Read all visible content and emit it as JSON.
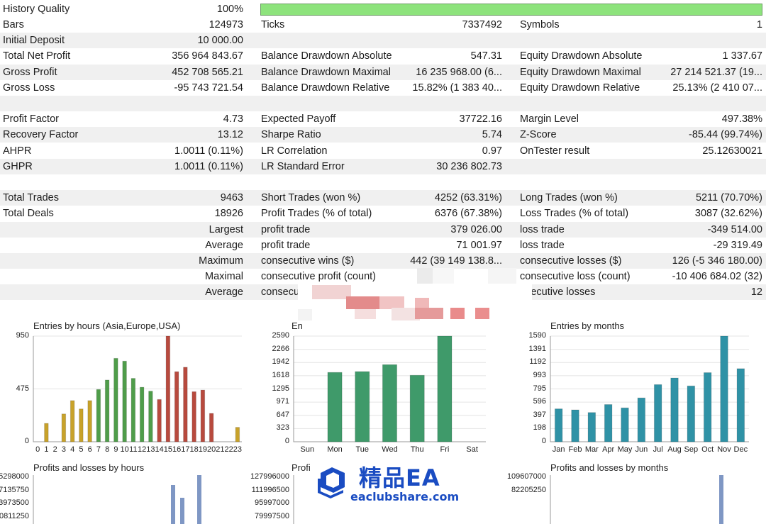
{
  "report": {
    "history_quality": {
      "label": "History Quality",
      "value": "100%",
      "fill": 1.0
    },
    "rows": [
      {
        "shade": false,
        "cells": [
          [
            "l1",
            "Bars"
          ],
          [
            "v1",
            "124973"
          ],
          [
            "l2",
            "Ticks"
          ],
          [
            "v2",
            "7337492"
          ],
          [
            "l3",
            "Symbols"
          ],
          [
            "v3",
            "1"
          ]
        ]
      },
      {
        "shade": true,
        "cells": [
          [
            "l1",
            "Initial Deposit"
          ],
          [
            "v1",
            "10 000.00"
          ]
        ]
      },
      {
        "shade": false,
        "cells": [
          [
            "l1",
            "Total Net Profit"
          ],
          [
            "v1",
            "356 964 843.67"
          ],
          [
            "l2",
            "Balance Drawdown Absolute"
          ],
          [
            "v2",
            "547.31"
          ],
          [
            "l3",
            "Equity Drawdown Absolute"
          ],
          [
            "v3",
            "1 337.67"
          ]
        ]
      },
      {
        "shade": true,
        "cells": [
          [
            "l1",
            "Gross Profit"
          ],
          [
            "v1",
            "452 708 565.21"
          ],
          [
            "l2",
            "Balance Drawdown Maximal"
          ],
          [
            "v2",
            "16 235 968.00 (6..."
          ],
          [
            "l3",
            "Equity Drawdown Maximal"
          ],
          [
            "v3",
            "27 214 521.37 (19..."
          ]
        ]
      },
      {
        "shade": false,
        "cells": [
          [
            "l1",
            "Gross Loss"
          ],
          [
            "v1",
            "-95 743 721.54"
          ],
          [
            "l2",
            "Balance Drawdown Relative"
          ],
          [
            "v2",
            "15.82% (1 383 40..."
          ],
          [
            "l3",
            "Equity Drawdown Relative"
          ],
          [
            "v3",
            "25.13% (2 410 07..."
          ]
        ]
      },
      {
        "shade": true,
        "cells": []
      },
      {
        "shade": false,
        "cells": [
          [
            "l1",
            "Profit Factor"
          ],
          [
            "v1",
            "4.73"
          ],
          [
            "l2",
            "Expected Payoff"
          ],
          [
            "v2",
            "37722.16"
          ],
          [
            "l3",
            "Margin Level"
          ],
          [
            "v3",
            "497.38%"
          ]
        ]
      },
      {
        "shade": true,
        "cells": [
          [
            "l1",
            "Recovery Factor"
          ],
          [
            "v1",
            "13.12"
          ],
          [
            "l2",
            "Sharpe Ratio"
          ],
          [
            "v2",
            "5.74"
          ],
          [
            "l3",
            "Z-Score"
          ],
          [
            "v3",
            "-85.44 (99.74%)"
          ]
        ]
      },
      {
        "shade": false,
        "cells": [
          [
            "l1",
            "AHPR"
          ],
          [
            "v1",
            "1.0011 (0.11%)"
          ],
          [
            "l2",
            "LR Correlation"
          ],
          [
            "v2",
            "0.97"
          ],
          [
            "l3",
            "OnTester result"
          ],
          [
            "v3",
            "25.12630021"
          ]
        ]
      },
      {
        "shade": true,
        "cells": [
          [
            "l1",
            "GHPR"
          ],
          [
            "v1",
            "1.0011 (0.11%)"
          ],
          [
            "l2",
            "LR Standard Error"
          ],
          [
            "v2",
            "30 236 802.73"
          ]
        ]
      },
      {
        "shade": false,
        "cells": []
      },
      {
        "shade": true,
        "cells": [
          [
            "l1",
            "Total Trades"
          ],
          [
            "v1",
            "9463"
          ],
          [
            "l2",
            "Short Trades (won %)"
          ],
          [
            "v2",
            "4252 (63.31%)"
          ],
          [
            "l3",
            "Long Trades (won %)"
          ],
          [
            "v3",
            "5211 (70.70%)"
          ]
        ]
      },
      {
        "shade": false,
        "cells": [
          [
            "l1",
            "Total Deals"
          ],
          [
            "v1",
            "18926"
          ],
          [
            "l2",
            "Profit Trades (% of total)"
          ],
          [
            "v2",
            "6376 (67.38%)"
          ],
          [
            "l3",
            "Loss Trades (% of total)"
          ],
          [
            "v3",
            "3087 (32.62%)"
          ]
        ]
      },
      {
        "shade": true,
        "cells": [
          [
            "r1",
            "Largest"
          ],
          [
            "l2",
            "profit trade"
          ],
          [
            "v2",
            "379 026.00"
          ],
          [
            "l3",
            "loss trade"
          ],
          [
            "v3",
            "-349 514.00"
          ]
        ]
      },
      {
        "shade": false,
        "cells": [
          [
            "r1",
            "Average"
          ],
          [
            "l2",
            "profit trade"
          ],
          [
            "v2",
            "71 001.97"
          ],
          [
            "l3",
            "loss trade"
          ],
          [
            "v3",
            "-29 319.49"
          ]
        ]
      },
      {
        "shade": true,
        "cells": [
          [
            "r1",
            "Maximum"
          ],
          [
            "l2",
            "consecutive wins ($)"
          ],
          [
            "v2",
            "442 (39 149 138.8..."
          ],
          [
            "l3",
            "consecutive losses ($)"
          ],
          [
            "v3",
            "126 (-5 346 180.00)"
          ]
        ]
      },
      {
        "shade": false,
        "cells": [
          [
            "r1",
            "Maximal"
          ],
          [
            "l2",
            "consecutive profit (count)"
          ],
          [
            "l3",
            "consecutive loss (count)"
          ],
          [
            "v3",
            "-10 406 684.02 (32)"
          ]
        ]
      },
      {
        "shade": true,
        "cells": [
          [
            "r1",
            "Average"
          ],
          [
            "l2",
            "consecut"
          ],
          [
            "l3",
            "nsecutive losses"
          ],
          [
            "v3",
            "12"
          ]
        ]
      },
      {
        "shade": false,
        "cells": []
      }
    ]
  },
  "charts": {
    "hours": {
      "title": "Entries by hours (Asia,Europe,USA)",
      "yticks": [
        "950",
        "475",
        "0"
      ],
      "chart_data": {
        "type": "bar",
        "categories": [
          "0",
          "1",
          "2",
          "3",
          "4",
          "5",
          "6",
          "7",
          "8",
          "9",
          "10",
          "11",
          "12",
          "13",
          "14",
          "15",
          "16",
          "17",
          "18",
          "19",
          "20",
          "21",
          "22",
          "23"
        ],
        "values": [
          0,
          165,
          0,
          250,
          370,
          295,
          370,
          470,
          555,
          750,
          725,
          570,
          490,
          455,
          380,
          950,
          630,
          670,
          450,
          465,
          255,
          0,
          0,
          130
        ],
        "ylim": [
          0,
          950
        ],
        "colors": [
          "#c8a22a",
          "#c8a22a",
          "#c8a22a",
          "#c8a22a",
          "#c8a22a",
          "#c8a22a",
          "#c8a22a",
          "#4f9d4a",
          "#4f9d4a",
          "#4f9d4a",
          "#4f9d4a",
          "#4f9d4a",
          "#4f9d4a",
          "#4f9d4a",
          "#b84a3e",
          "#b84a3e",
          "#b84a3e",
          "#b84a3e",
          "#b84a3e",
          "#b84a3e",
          "#b84a3e",
          "#b84a3e",
          "#c8a22a",
          "#c8a22a"
        ]
      }
    },
    "weekdays": {
      "title": "En",
      "yticks": [
        "2590",
        "2266",
        "1942",
        "1618",
        "1295",
        "971",
        "647",
        "323",
        "0"
      ],
      "chart_data": {
        "type": "bar",
        "categories": [
          "Sun",
          "Mon",
          "Tue",
          "Wed",
          "Thu",
          "Fri",
          "Sat"
        ],
        "values": [
          0,
          1700,
          1720,
          1890,
          1630,
          2590,
          0
        ],
        "ylim": [
          0,
          2590
        ],
        "color": "#3f9a6a"
      }
    },
    "months": {
      "title": "Entries by months",
      "yticks": [
        "1590",
        "1391",
        "1192",
        "993",
        "795",
        "596",
        "397",
        "198",
        "0"
      ],
      "chart_data": {
        "type": "bar",
        "categories": [
          "Jan",
          "Feb",
          "Mar",
          "Apr",
          "May",
          "Jun",
          "Jul",
          "Aug",
          "Sep",
          "Oct",
          "Nov",
          "Dec"
        ],
        "values": [
          495,
          480,
          440,
          560,
          510,
          660,
          860,
          960,
          840,
          1040,
          1590,
          1100
        ],
        "ylim": [
          0,
          1590
        ],
        "color": "#2f92a6"
      }
    },
    "pl_hours": {
      "title": "Profits and losses by hours",
      "yticks": [
        "5298000",
        "7135750",
        "3973500",
        "0811250"
      ]
    },
    "pl_weekdays": {
      "title": "Profi",
      "yticks": [
        "127996000",
        "111996500",
        "95997000",
        "79997500"
      ]
    },
    "pl_months": {
      "title": "Profits and losses by months",
      "yticks": [
        "109607000",
        "82205250"
      ]
    }
  },
  "watermark": {
    "brand": "精品EA",
    "url": "eaclubshare.com"
  }
}
